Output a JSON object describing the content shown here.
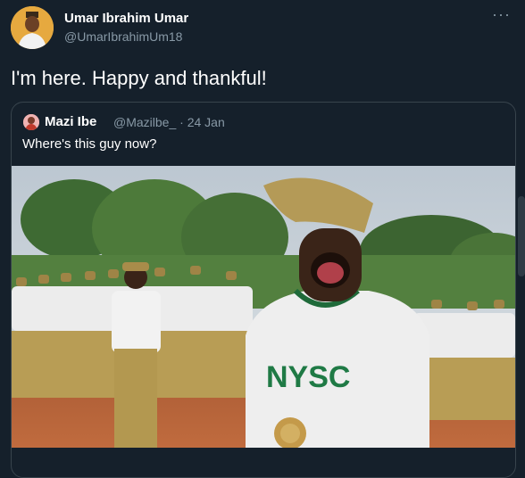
{
  "author": {
    "name": "Umar Ibrahim Umar",
    "handle": "@UmarIbrahimUm18",
    "avatar_icon": "profile-photo"
  },
  "more_icon": "ellipsis-icon",
  "tweet": {
    "text": "I'm here. Happy and thankful!"
  },
  "quoted": {
    "name": "Mazi Ibe",
    "handle": "@Mazilbe_",
    "date": "· 24 Jan",
    "text": "Where's this guy now?",
    "image": {
      "shirt_text": "NYSC",
      "colors": {
        "sky": "#c9d3dc",
        "trees": "#3f6b35",
        "ground": "#b5643a",
        "khaki": "#b59a52"
      }
    }
  },
  "colors": {
    "background": "#15202b",
    "secondary_text": "#8899a6",
    "border": "#38444d"
  }
}
